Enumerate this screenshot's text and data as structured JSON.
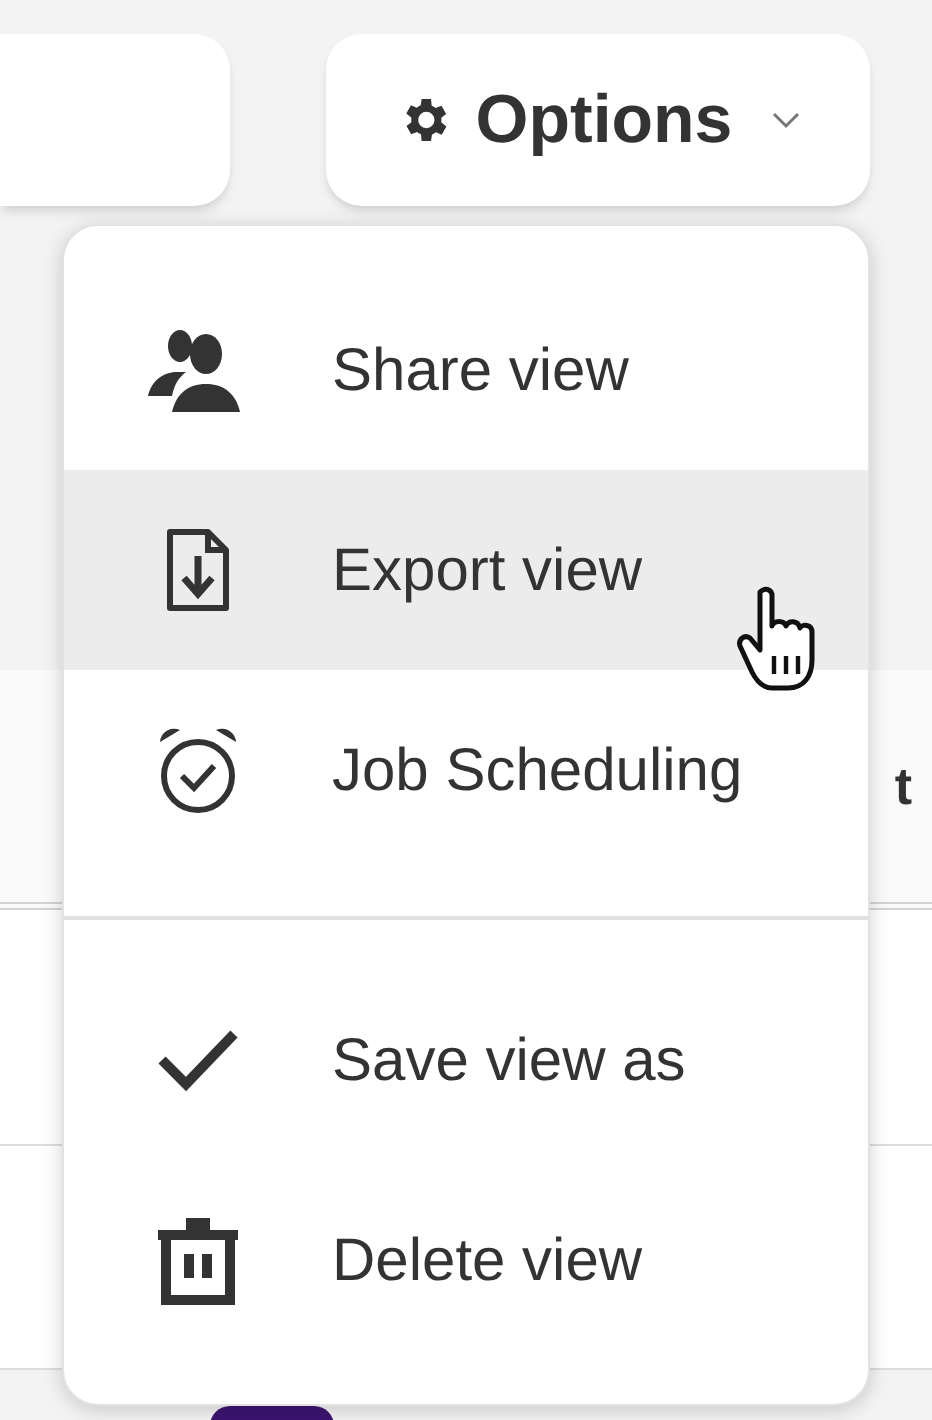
{
  "options_button": {
    "label": "Options"
  },
  "menu": {
    "sections": [
      [
        {
          "label": "Share view",
          "highlighted": false
        },
        {
          "label": "Export view",
          "highlighted": true
        },
        {
          "label": "Job Scheduling",
          "highlighted": false
        }
      ],
      [
        {
          "label": "Save view as",
          "highlighted": false
        },
        {
          "label": "Delete view",
          "highlighted": false
        }
      ]
    ]
  },
  "table": {
    "column_fragment": "t"
  }
}
